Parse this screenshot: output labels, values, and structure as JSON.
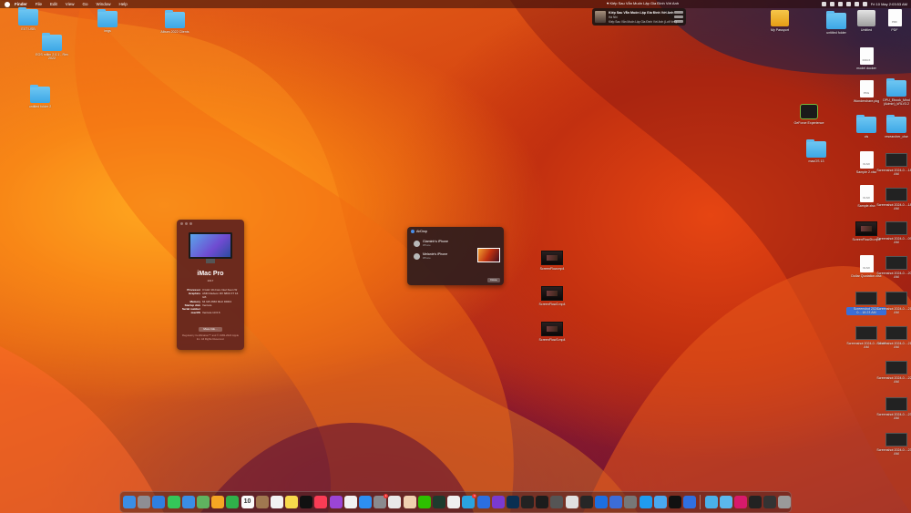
{
  "menubar": {
    "menus": [
      "Finder",
      "File",
      "Edit",
      "View",
      "Go",
      "Window",
      "Help"
    ],
    "now_playing_text": "♥ Kiếp Sau Vẫn Muốn Lập Gia Đình Với Anh",
    "status_clock": "Fri 10 May  2:03:53 AM"
  },
  "now_playing": {
    "title": "Kiếp Sau Vẫn Muốn Lập Gia Đình Với Anh",
    "artist": "Hà Nhi",
    "album": "Kiếp Sau Vẫn Muốn Lập Gia Đình Với Anh (Lofi Ver.)"
  },
  "desktop_left": [
    {
      "label": "EXT USB",
      "kind": "folder"
    },
    {
      "label": "imgs",
      "kind": "folder"
    },
    {
      "label": "Album 2022 Clients",
      "kind": "folder"
    },
    {
      "label": "EOS mfilm 2.0.1 - Rev 2022",
      "kind": "folder"
    },
    {
      "label": "untitled folder 2",
      "kind": "folder"
    }
  ],
  "desktop_middle": [
    {
      "label": "ScreenFlow.mp4",
      "kind": "video"
    },
    {
      "label": "ScreenFlow2.mp4",
      "kind": "video"
    },
    {
      "label": "ScreenFlow3.mp4",
      "kind": "video"
    }
  ],
  "desktop_right": [
    {
      "label": "My Passport",
      "kind": "drive-yellow"
    },
    {
      "label": "untitled folder",
      "kind": "folder"
    },
    {
      "label": "Untitled",
      "kind": "drive-gray"
    },
    {
      "label": "PDF",
      "kind": "doc",
      "tag": "PDF"
    },
    {
      "label": "model docker",
      "kind": "doc",
      "tag": "DOCX"
    },
    {
      "label": "Wondershare.pkg",
      "kind": "doc",
      "tag": "PKG"
    },
    {
      "label": "DPU_Ebook_Mind (Admin)_kRLV3.2",
      "kind": "folder"
    },
    {
      "label": "GeForce Experience",
      "kind": "app"
    },
    {
      "label": "cls",
      "kind": "folder"
    },
    {
      "label": "researcher_clse",
      "kind": "folder"
    },
    {
      "label": "macOS 13",
      "kind": "folder"
    },
    {
      "label": "Sample 2.xlsx",
      "kind": "doc",
      "tag": "XLSX"
    },
    {
      "label": "Screenshot 2024-0....18.02 AM",
      "kind": "shot"
    },
    {
      "label": "Sample.xlsx",
      "kind": "doc",
      "tag": "XLSX"
    },
    {
      "label": "Screenshot 2024-0....18.12 AM",
      "kind": "shot"
    },
    {
      "label": "ScreenFlow2b.mp4",
      "kind": "video"
    },
    {
      "label": "Screenshot 2024-0....09.38 AM",
      "kind": "shot"
    },
    {
      "label": "Dollar Quotation.xlsx",
      "kind": "doc",
      "tag": "XLSX"
    },
    {
      "label": "Screenshot 2024-0....20.38 AM",
      "kind": "shot"
    },
    {
      "label": "Screenshot 2024-0....18.23 AM",
      "kind": "shot"
    },
    {
      "label": "Screenshot 2024-0....21.18 AM",
      "kind": "shot"
    },
    {
      "label": "Screenshot 2024-0....23.43 AM",
      "kind": "shot"
    },
    {
      "label": "Screenshot 2024-0....21.53 AM",
      "kind": "shot"
    },
    {
      "label": "Screenshot 2024-0....22.53 AM",
      "kind": "shot"
    },
    {
      "label": "Screenshot 2024-0....23.15 AM",
      "kind": "shot"
    },
    {
      "label": "Screenshot 2024-0....23.48 AM",
      "kind": "shot"
    }
  ],
  "about": {
    "model": "iMac Pro",
    "year": "2017",
    "specs": [
      {
        "k": "Processor",
        "v": "3 GHz 10-Core Intel Xeon W"
      },
      {
        "k": "Graphics",
        "v": "AMD Radeon RX 6800 XT 16 GB"
      },
      {
        "k": "Memory",
        "v": "64 GB 2666 MHz DDR4"
      },
      {
        "k": "Startup disk",
        "v": "Ventura"
      },
      {
        "k": "Serial number",
        "v": ""
      },
      {
        "k": "macOS",
        "v": "Ventura 13.6.6"
      }
    ],
    "more_button": "More Info...",
    "reg": "Regulatory Certification™ and © 1983-2024 Apple Inc. All Rights Reserved."
  },
  "airdrop": {
    "title": "AirDrop",
    "devices": [
      {
        "name": "Giaminh's iPhone",
        "status": "iPhone"
      },
      {
        "name": "Melanie's iPhone",
        "status": "iPhone"
      }
    ],
    "done": "Done"
  },
  "dock": {
    "calendar_day": "10",
    "apps": [
      {
        "name": "finder",
        "color": "#3a8ee6"
      },
      {
        "name": "launchpad",
        "color": "#8e8e93"
      },
      {
        "name": "safari",
        "color": "#2f7fe0"
      },
      {
        "name": "messages",
        "color": "#34c759"
      },
      {
        "name": "mail",
        "color": "#3a8ee6"
      },
      {
        "name": "maps",
        "color": "#5fb35f"
      },
      {
        "name": "photos",
        "color": "#f5a623"
      },
      {
        "name": "facetime",
        "color": "#30b04a"
      },
      {
        "name": "calendar",
        "color": "#fafafa"
      },
      {
        "name": "contacts",
        "color": "#a07850"
      },
      {
        "name": "reminders",
        "color": "#f2f2f2"
      },
      {
        "name": "notes",
        "color": "#f7d94c"
      },
      {
        "name": "apple-tv",
        "color": "#111111"
      },
      {
        "name": "music",
        "color": "#fa3c55"
      },
      {
        "name": "podcasts",
        "color": "#9b45d6"
      },
      {
        "name": "news",
        "color": "#f2f2f2"
      },
      {
        "name": "app-store",
        "color": "#2d8ff2"
      },
      {
        "name": "system-settings",
        "color": "#8a8a8e",
        "badge": "1"
      },
      {
        "name": "preview",
        "color": "#e8e8e8"
      },
      {
        "name": "emoji-app",
        "color": "#f0d0b0"
      },
      {
        "name": "wechat",
        "color": "#2dc100"
      },
      {
        "name": "terminal-app",
        "color": "#1e3b2e"
      },
      {
        "name": "chrome",
        "color": "#f0f0f0"
      },
      {
        "name": "telegram",
        "color": "#2aa3e0",
        "badge": "3"
      },
      {
        "name": "hex-app",
        "color": "#2b6fe0"
      },
      {
        "name": "dart-app",
        "color": "#7a3ad0"
      },
      {
        "name": "photoshop",
        "color": "#0a2f52"
      },
      {
        "name": "screen-app",
        "color": "#222222"
      },
      {
        "name": "settings-app",
        "color": "#1c1c1c"
      },
      {
        "name": "capture-app",
        "color": "#555555"
      },
      {
        "name": "fcp",
        "color": "#e0e0e0"
      },
      {
        "name": "z-app",
        "color": "#262626"
      },
      {
        "name": "xcode",
        "color": "#1d6fe0"
      },
      {
        "name": "creative-app",
        "color": "#3c6dd8"
      },
      {
        "name": "sys-prefs",
        "color": "#777777"
      },
      {
        "name": "blue-app",
        "color": "#1f9cf0"
      },
      {
        "name": "cloud-app",
        "color": "#4aa8f0"
      },
      {
        "name": "terminal",
        "color": "#111111"
      },
      {
        "name": "xcode-tools",
        "color": "#3070e0"
      },
      {
        "name": "sep"
      },
      {
        "name": "folder-dl",
        "color": "#4ab0ea"
      },
      {
        "name": "folder-docs",
        "color": "#5bb8ee"
      },
      {
        "name": "tiktok",
        "color": "#d81a6b"
      },
      {
        "name": "dark-app",
        "color": "#222222"
      },
      {
        "name": "image-app",
        "color": "#333333"
      },
      {
        "name": "trash",
        "color": "#9a9a9a"
      }
    ]
  }
}
